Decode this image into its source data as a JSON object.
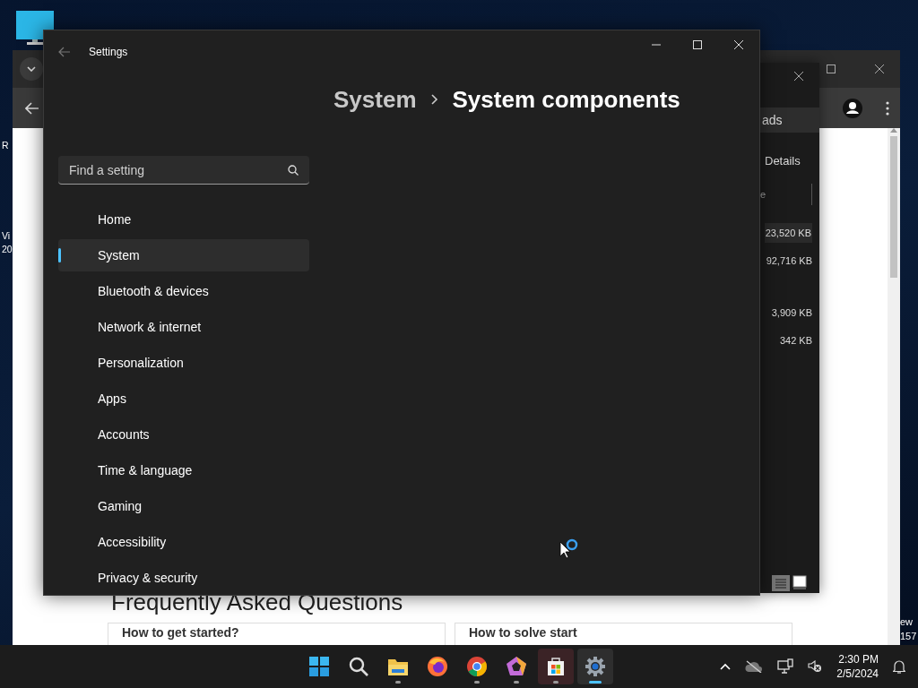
{
  "desktop": {
    "left_texts": [
      "R",
      "Vi",
      "20"
    ],
    "right_texts": [
      "ew",
      "157"
    ]
  },
  "browser": {
    "faq_title": "Frequently Asked Questions",
    "cards": [
      "How to get started?",
      "How to solve start"
    ]
  },
  "task_manager": {
    "tab": "ads",
    "details": "Details",
    "column": "e",
    "values": [
      "23,520 KB",
      "92,716 KB",
      "3,909 KB",
      "342 KB"
    ]
  },
  "settings": {
    "title": "Settings",
    "breadcrumb": [
      "System",
      "System components"
    ],
    "search": {
      "placeholder": "Find a setting"
    },
    "nav": [
      {
        "label": "Home",
        "selected": false
      },
      {
        "label": "System",
        "selected": true
      },
      {
        "label": "Bluetooth & devices",
        "selected": false
      },
      {
        "label": "Network & internet",
        "selected": false
      },
      {
        "label": "Personalization",
        "selected": false
      },
      {
        "label": "Apps",
        "selected": false
      },
      {
        "label": "Accounts",
        "selected": false
      },
      {
        "label": "Time & language",
        "selected": false
      },
      {
        "label": "Gaming",
        "selected": false
      },
      {
        "label": "Accessibility",
        "selected": false
      },
      {
        "label": "Privacy & security",
        "selected": false
      }
    ]
  },
  "taskbar": {
    "apps": [
      {
        "kind": "start",
        "running": false,
        "selected": false
      },
      {
        "kind": "search",
        "running": false,
        "selected": false
      },
      {
        "kind": "folder",
        "running": true,
        "selected": false
      },
      {
        "kind": "firefox",
        "running": false,
        "selected": false
      },
      {
        "kind": "chrome",
        "running": true,
        "selected": false
      },
      {
        "kind": "pentagon",
        "running": true,
        "selected": false
      },
      {
        "kind": "store",
        "running": true,
        "selected": false
      },
      {
        "kind": "settings",
        "running": true,
        "selected": true
      }
    ],
    "time": "2:30 PM",
    "date": "2/5/2024"
  }
}
